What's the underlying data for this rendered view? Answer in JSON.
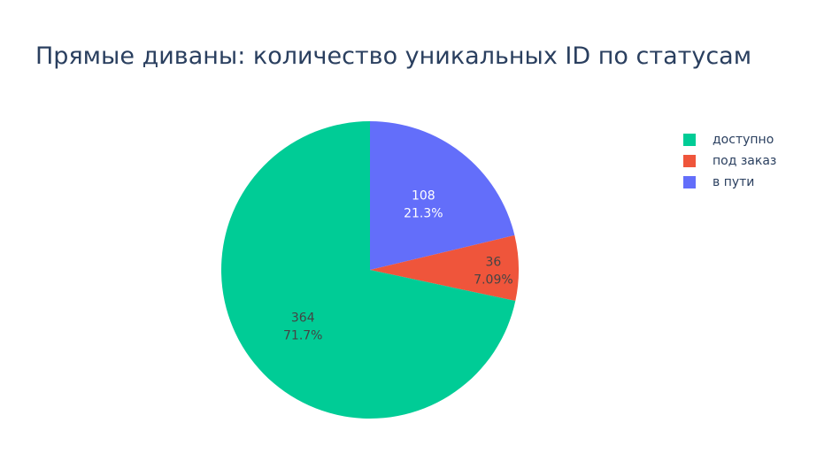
{
  "title": "Прямые диваны: количество уникальных ID по статусам",
  "chart_data": {
    "type": "pie",
    "title": "Прямые диваны: количество уникальных ID по статусам",
    "legend_position": "right",
    "direction": "clockwise",
    "start_angle_deg": 0,
    "slice_order": [
      "в пути",
      "под заказ",
      "доступно"
    ],
    "slices": [
      {
        "label": "в пути",
        "value": 108,
        "percent": "21.3%",
        "color": "#636efa",
        "text_color": "#ffffff"
      },
      {
        "label": "под заказ",
        "value": 36,
        "percent": "7.09%",
        "color": "#ef553b",
        "text_color": "#444444"
      },
      {
        "label": "доступно",
        "value": 364,
        "percent": "71.7%",
        "color": "#00cc96",
        "text_color": "#444444"
      }
    ]
  },
  "legend": [
    {
      "label": "доступно",
      "color": "#00cc96"
    },
    {
      "label": "под заказ",
      "color": "#ef553b"
    },
    {
      "label": "в пути",
      "color": "#636efa"
    }
  ]
}
